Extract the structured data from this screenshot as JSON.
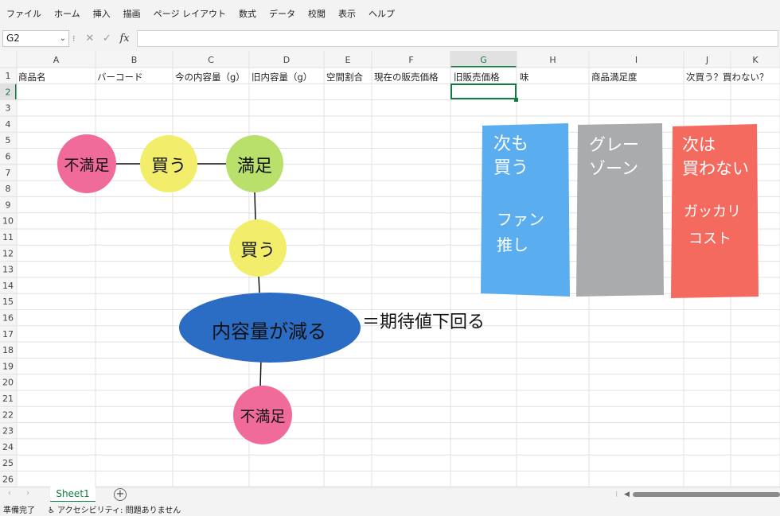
{
  "menu": [
    "ファイル",
    "ホーム",
    "挿入",
    "描画",
    "ページ レイアウト",
    "数式",
    "データ",
    "校閲",
    "表示",
    "ヘルプ"
  ],
  "name_box": "G2",
  "columns": [
    "A",
    "B",
    "C",
    "D",
    "E",
    "F",
    "G",
    "H",
    "I",
    "J",
    "K"
  ],
  "rows": [
    "1",
    "2",
    "3",
    "4",
    "5",
    "6",
    "7",
    "8",
    "9",
    "10",
    "11",
    "12",
    "13",
    "14",
    "15",
    "16",
    "17",
    "18",
    "19",
    "20",
    "21",
    "22",
    "23",
    "24",
    "25",
    "26"
  ],
  "headers_row1": [
    "商品名",
    "バーコード",
    "今の内容量（g）",
    "旧内容量（g）",
    "空間割合",
    "現在の販売価格",
    "旧販売価格",
    "味",
    "商品満足度",
    "次買う？買わない？",
    ""
  ],
  "drawing": {
    "circle_fumanzoku_1": "不満足",
    "circle_kau_1": "買う",
    "circle_manzoku": "満足",
    "circle_kau_2": "買う",
    "ellipse": "内容量が減る",
    "expectation_text": "＝期待値下回る",
    "circle_fumanzoku_2": "不満足"
  },
  "cards": {
    "blue": {
      "title_line1": "次も",
      "title_line2": "買う",
      "sub_line1": "ファン",
      "sub_line2": "推し"
    },
    "gray": {
      "title_line1": "グレー",
      "title_line2": "ゾーン"
    },
    "red": {
      "title_line1": "次は",
      "title_line2": "買わない",
      "sub_line1": "ガッカリ",
      "sub_line2": "コスト"
    }
  },
  "colors": {
    "pink": "#f06a9a",
    "yellow": "#f2ee6b",
    "green": "#b8e06a",
    "blue_ellipse": "#2b6cc4",
    "blue_card": "#5aaef0",
    "gray_card": "#a9abad",
    "red_card": "#f56a5e",
    "excel_green": "#107c41"
  },
  "sheet_tab": "Sheet1",
  "status": {
    "ready": "準備完了",
    "accessibility": "アクセシビリティ: 問題ありません"
  }
}
